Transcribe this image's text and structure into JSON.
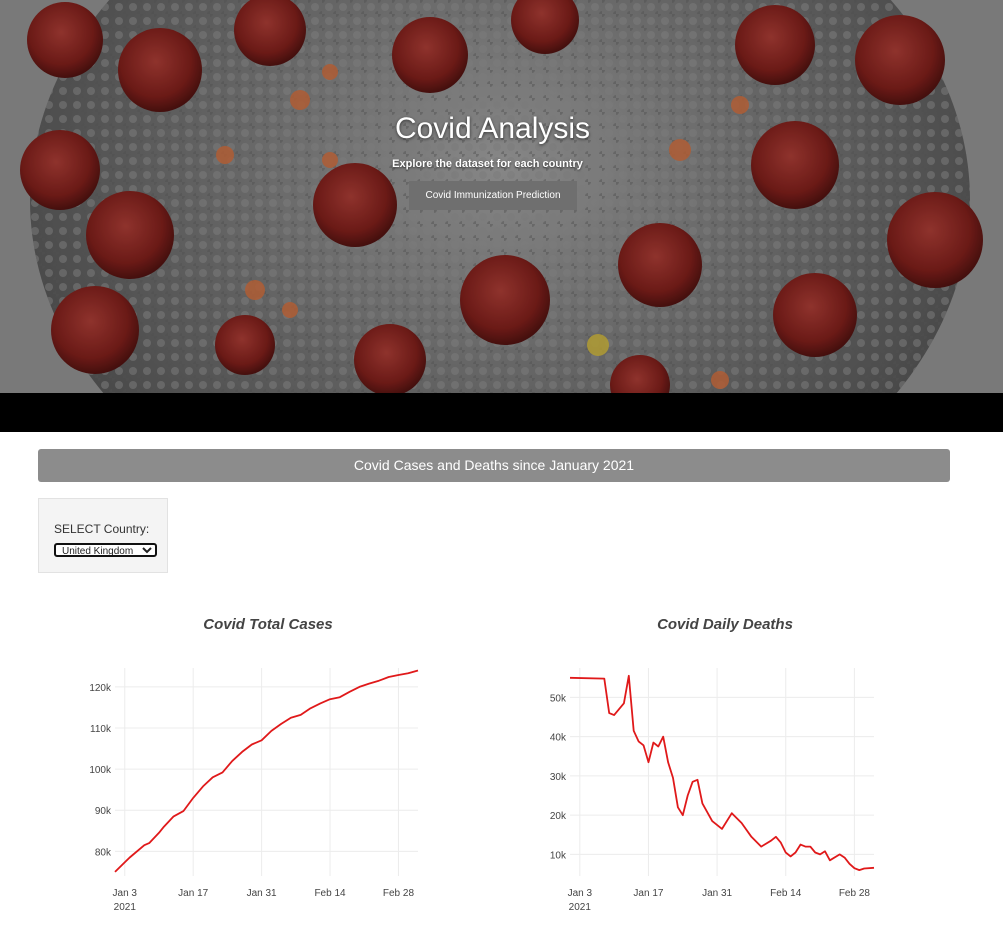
{
  "hero": {
    "title": "Covid Analysis",
    "subtitle": "Explore the dataset for each country",
    "button_label": "Covid Immunization Prediction"
  },
  "section": {
    "title": "Covid Cases and Deaths since January 2021"
  },
  "selector": {
    "label": "SELECT Country:",
    "selected": "United Kingdom"
  },
  "colors": {
    "line": "#e0191a",
    "section_bar": "#8c8c8c",
    "grid": "#ececec"
  },
  "chart_data": [
    {
      "type": "line",
      "title": "Covid Total Cases",
      "x_ticks": [
        "Jan 3",
        "Jan 17",
        "Jan 31",
        "Feb 14",
        "Feb 28"
      ],
      "x_tick_sublabel": "2021",
      "x_start": "2021-01-01",
      "x_range": [
        "2021-01-01",
        "2021-03-04"
      ],
      "y_ticks": [
        80000,
        90000,
        100000,
        110000,
        120000
      ],
      "y_tick_labels": [
        "80k",
        "90k",
        "100k",
        "110k",
        "120k"
      ],
      "ylim": [
        74000,
        124600
      ],
      "grid": true,
      "series": [
        {
          "x": [
            "2021-01-01",
            "2021-01-04",
            "2021-01-07",
            "2021-01-08",
            "2021-01-10",
            "2021-01-11",
            "2021-01-13",
            "2021-01-15",
            "2021-01-17",
            "2021-01-19",
            "2021-01-21",
            "2021-01-23",
            "2021-01-25",
            "2021-01-27",
            "2021-01-29",
            "2021-01-31",
            "2021-02-02",
            "2021-02-04",
            "2021-02-06",
            "2021-02-08",
            "2021-02-10",
            "2021-02-12",
            "2021-02-14",
            "2021-02-16",
            "2021-02-18",
            "2021-02-20",
            "2021-02-22",
            "2021-02-24",
            "2021-02-26",
            "2021-02-28",
            "2021-03-02",
            "2021-03-04"
          ],
          "values": [
            75000,
            78500,
            81500,
            82000,
            84500,
            86000,
            88500,
            89800,
            93000,
            95800,
            98000,
            99200,
            102000,
            104200,
            106000,
            107000,
            109300,
            111000,
            112500,
            113200,
            114800,
            116000,
            117000,
            117500,
            118800,
            120000,
            120800,
            121500,
            122400,
            122900,
            123300,
            124000
          ]
        }
      ]
    },
    {
      "type": "line",
      "title": "Covid Daily Deaths",
      "x_ticks": [
        "Jan 3",
        "Jan 17",
        "Jan 31",
        "Feb 14",
        "Feb 28"
      ],
      "x_tick_sublabel": "2021",
      "x_start": "2021-01-01",
      "x_range": [
        "2021-01-01",
        "2021-03-04"
      ],
      "y_ticks": [
        10000,
        20000,
        30000,
        40000,
        50000
      ],
      "y_tick_labels": [
        "10k",
        "20k",
        "30k",
        "40k",
        "50k"
      ],
      "ylim": [
        4500,
        57500
      ],
      "grid": true,
      "series": [
        {
          "x": [
            "2021-01-01",
            "2021-01-08",
            "2021-01-09",
            "2021-01-10",
            "2021-01-11",
            "2021-01-12",
            "2021-01-13",
            "2021-01-14",
            "2021-01-15",
            "2021-01-16",
            "2021-01-17",
            "2021-01-18",
            "2021-01-19",
            "2021-01-20",
            "2021-01-21",
            "2021-01-22",
            "2021-01-23",
            "2021-01-24",
            "2021-01-25",
            "2021-01-26",
            "2021-01-27",
            "2021-01-28",
            "2021-01-30",
            "2021-02-01",
            "2021-02-03",
            "2021-02-05",
            "2021-02-07",
            "2021-02-09",
            "2021-02-11",
            "2021-02-12",
            "2021-02-13",
            "2021-02-14",
            "2021-02-15",
            "2021-02-16",
            "2021-02-17",
            "2021-02-18",
            "2021-02-19",
            "2021-02-20",
            "2021-02-21",
            "2021-02-22",
            "2021-02-23",
            "2021-02-25",
            "2021-02-26",
            "2021-02-27",
            "2021-02-28",
            "2021-03-01",
            "2021-03-02",
            "2021-03-04"
          ],
          "values": [
            55000,
            54800,
            46000,
            45500,
            47000,
            48500,
            55500,
            41500,
            38800,
            37800,
            33500,
            38500,
            37500,
            40000,
            33500,
            29500,
            22000,
            20000,
            25000,
            28500,
            29000,
            23000,
            18500,
            16500,
            20500,
            18000,
            14500,
            12000,
            13500,
            14500,
            13000,
            10500,
            9500,
            10500,
            12500,
            12000,
            12000,
            10500,
            10000,
            10800,
            8500,
            10000,
            9200,
            7600,
            6500,
            6000,
            6400,
            6600
          ]
        }
      ]
    }
  ]
}
